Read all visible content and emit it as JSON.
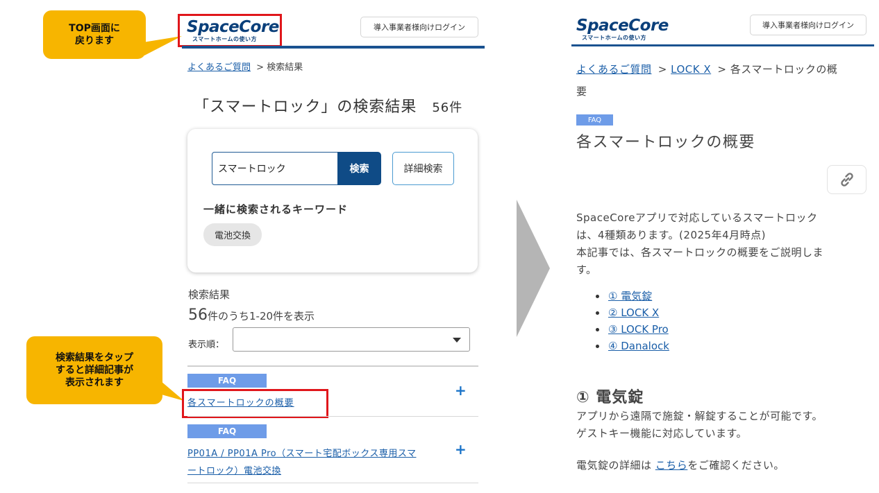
{
  "callouts": {
    "top": "TOP画面に\n戻ります",
    "result": "検索結果をタップ\nすると詳細記事が\n表示されます"
  },
  "left": {
    "logo": {
      "main": "SpaceCore",
      "sub": "スマートホームの使い方"
    },
    "login_label": "導入事業者様向けログイン",
    "breadcrumb": {
      "home": "よくあるご質問",
      "separator": ">",
      "current": "検索結果"
    },
    "heading": "「スマートロック」の検索結果",
    "count_label": "56件",
    "search": {
      "value": "スマートロック",
      "button": "検索",
      "advanced": "詳細検索",
      "related_heading": "一緒に検索されるキーワード",
      "related_keyword": "電池交換"
    },
    "results": {
      "heading": "検索結果",
      "count_number": "56",
      "count_text": "件のうち1-20件を表示",
      "sort_label": "表示順：",
      "sort_value": ""
    },
    "items": [
      {
        "tag": "FAQ",
        "title": "各スマートロックの概要"
      },
      {
        "tag": "FAQ",
        "title_line1": "PP01A / PP01A Pro（スマート宅配ボックス専用スマ",
        "title_line2": "ートロック）電池交換"
      }
    ]
  },
  "right": {
    "logo": {
      "main": "SpaceCore",
      "sub": "スマートホームの使い方"
    },
    "login_label": "導入事業者様向けログイン",
    "breadcrumb": {
      "home": "よくあるご質問",
      "sep1": ">",
      "mid": "LOCK X",
      "sep2": ">",
      "current_line1": "各スマートロックの概",
      "current_line2": "要"
    },
    "tag": "FAQ",
    "title": "各スマートロックの概要",
    "intro": [
      "SpaceCoreアプリで対応しているスマートロック",
      "は、4種類あります。(2025年4月時点)",
      "本記事では、各スマートロックの概要をご説明しま",
      "す。"
    ],
    "toc": [
      "① 電気錠",
      "② LOCK X",
      "③ LOCK Pro",
      "④ Danalock"
    ],
    "section_heading": "① 電気錠",
    "section_lines": [
      "アプリから遠隔で施錠・解錠することが可能です。",
      "ゲストキー機能に対応しています。"
    ],
    "detail_prefix": "電気錠の詳細は",
    "detail_link": "こちら",
    "detail_suffix": "をご確認ください。"
  },
  "colors": {
    "callout": "#f7b500",
    "brand": "#0a3f7a",
    "search_button": "#0f4b86",
    "faq_tag": "#6e9ce8",
    "highlight_box": "#e0161b",
    "arrow": "#b5b5b5"
  }
}
